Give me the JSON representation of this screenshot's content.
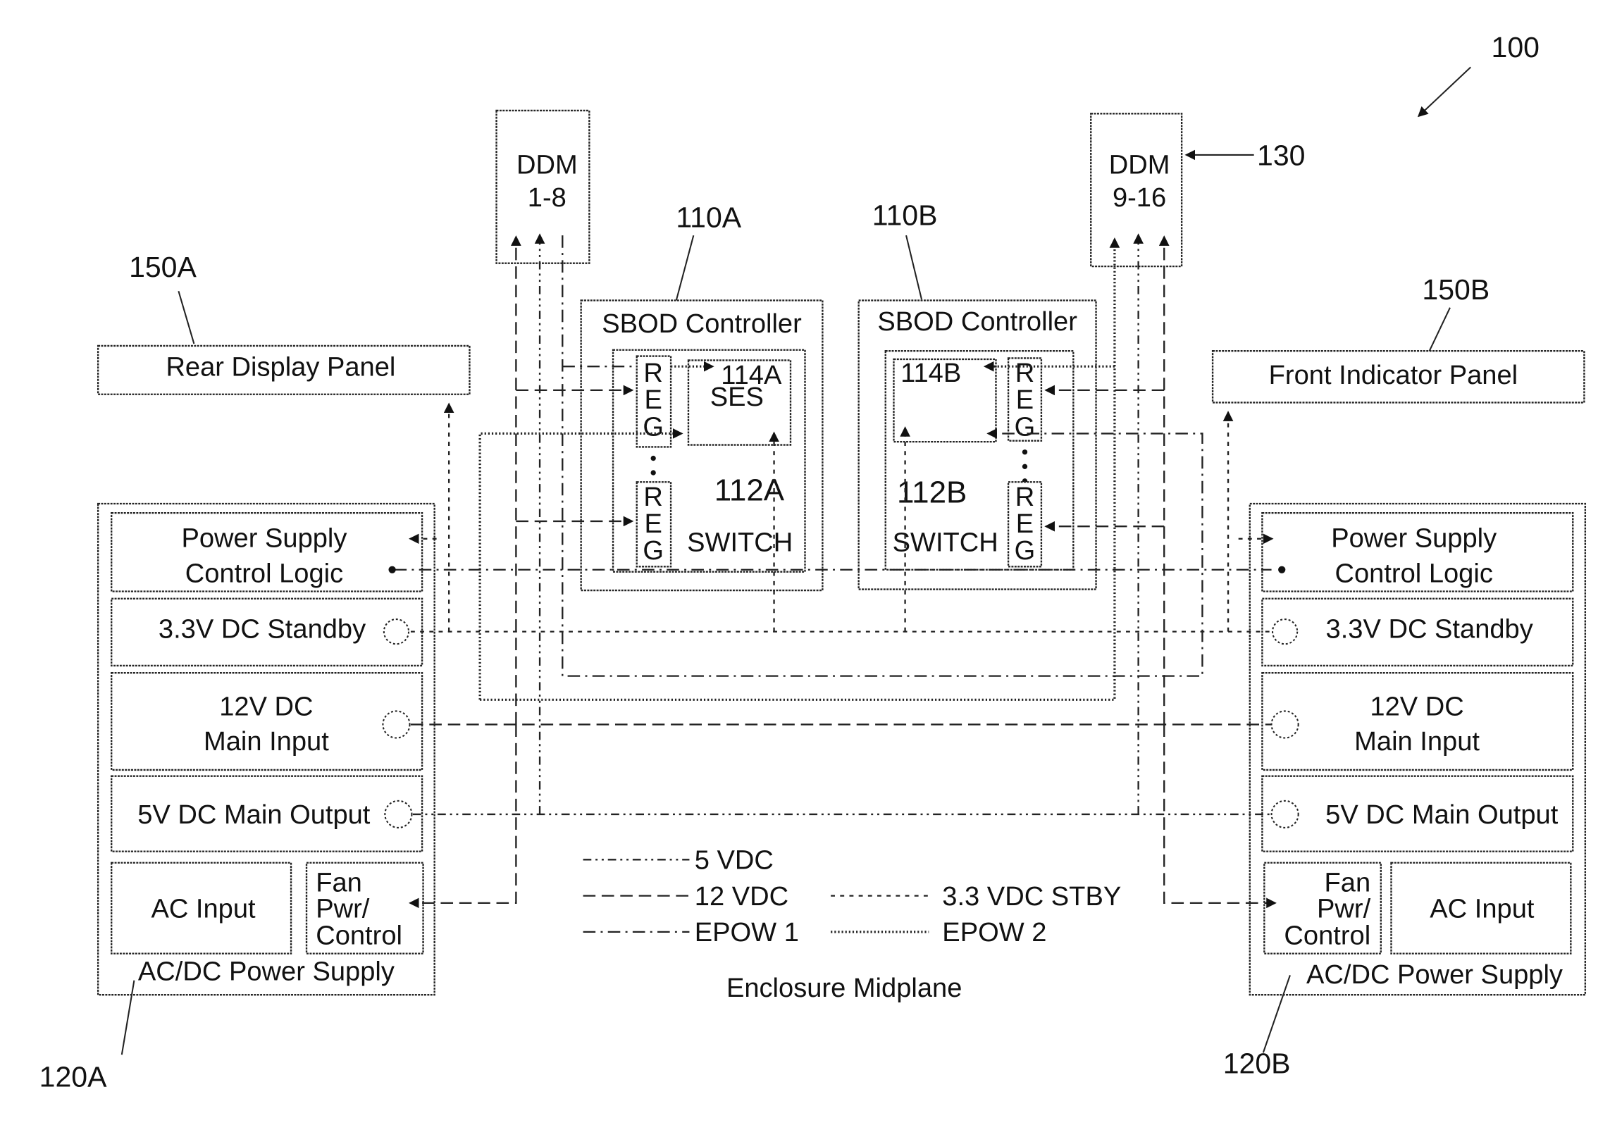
{
  "figure": {
    "ref": "100",
    "caption": "Enclosure Midplane"
  },
  "ddm": [
    {
      "title": "DDM",
      "range": "1-8"
    },
    {
      "title": "DDM",
      "range": "9-16",
      "ref": "130"
    }
  ],
  "controllers": [
    {
      "ref": "110A",
      "title": "SBOD Controller",
      "switch_ref": "112A",
      "switch_label": "SWITCH",
      "ses_ref": "114A",
      "ses_label": "SES",
      "reg_letters": [
        "R",
        "E",
        "G"
      ]
    },
    {
      "ref": "110B",
      "title": "SBOD Controller",
      "switch_ref": "112B",
      "switch_label": "SWITCH",
      "ses_ref": "114B",
      "reg_letters": [
        "R",
        "E",
        "G"
      ]
    }
  ],
  "panels": [
    {
      "ref": "150A",
      "label": "Rear Display Panel"
    },
    {
      "ref": "150B",
      "label": "Front Indicator Panel"
    }
  ],
  "power_supplies": [
    {
      "ref": "120A",
      "title": "AC/DC Power Supply",
      "control_logic": [
        "Power Supply",
        "Control Logic"
      ],
      "standby": "3.3V DC Standby",
      "main_input": [
        "12V DC",
        "Main Input"
      ],
      "main_output": "5V DC Main Output",
      "ac_input": "AC Input",
      "fan": [
        "Fan",
        "Pwr/",
        "Control"
      ]
    },
    {
      "ref": "120B",
      "title": "AC/DC Power Supply",
      "control_logic": [
        "Power Supply",
        "Control Logic"
      ],
      "standby": "3.3V DC Standby",
      "main_input": [
        "12V DC",
        "Main Input"
      ],
      "main_output": "5V DC Main Output",
      "ac_input": "AC Input",
      "fan": [
        "Fan",
        "Pwr/",
        "Control"
      ]
    }
  ],
  "legend": [
    {
      "key": "5vdc",
      "label": "5 VDC"
    },
    {
      "key": "12vdc",
      "label": "12 VDC"
    },
    {
      "key": "epow1",
      "label": "EPOW 1"
    },
    {
      "key": "stby",
      "label": "3.3 VDC STBY"
    },
    {
      "key": "epow2",
      "label": "EPOW 2"
    }
  ]
}
